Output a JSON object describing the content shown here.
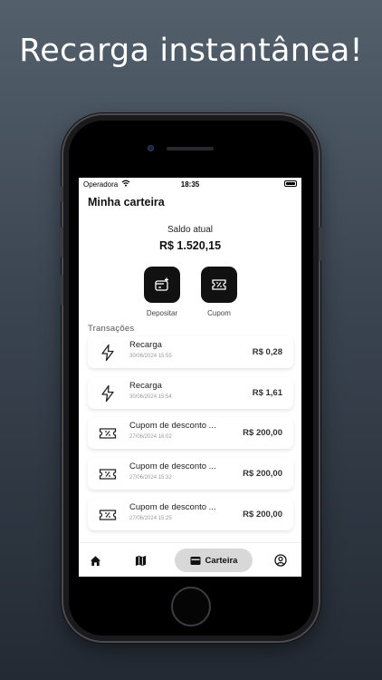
{
  "headline": "Recarga instantânea!",
  "status_bar": {
    "carrier": "Operadora",
    "time": "18:35"
  },
  "header": {
    "title": "Minha carteira"
  },
  "balance": {
    "label": "Saldo atual",
    "value": "R$ 1.520,15"
  },
  "actions": [
    {
      "label": "Depositar",
      "icon": "deposit-icon"
    },
    {
      "label": "Cupom",
      "icon": "ticket-icon"
    }
  ],
  "transactions": {
    "title": "Transações",
    "items": [
      {
        "name": "Recarga",
        "date": "30/06/2024  15:55",
        "amount": "R$ 0,28",
        "icon": "lightning-icon"
      },
      {
        "name": "Recarga",
        "date": "30/06/2024  15:54",
        "amount": "R$ 1,61",
        "icon": "lightning-icon"
      },
      {
        "name": "Cupom de desconto ...",
        "date": "27/06/2024  16:02",
        "amount": "R$ 200,00",
        "icon": "ticket-icon"
      },
      {
        "name": "Cupom de desconto ...",
        "date": "27/06/2024  15:32",
        "amount": "R$ 200,00",
        "icon": "ticket-icon"
      },
      {
        "name": "Cupom de desconto ...",
        "date": "27/06/2024  15:25",
        "amount": "R$ 200,00",
        "icon": "ticket-icon"
      }
    ]
  },
  "nav": {
    "items": [
      {
        "icon": "home-icon"
      },
      {
        "icon": "map-icon"
      },
      {
        "label": "Carteira",
        "icon": "wallet-icon",
        "active": true
      },
      {
        "icon": "profile-icon"
      }
    ]
  },
  "colors": {
    "accent": "#111111",
    "background_top": "#53606c",
    "background_bottom": "#232a33"
  }
}
